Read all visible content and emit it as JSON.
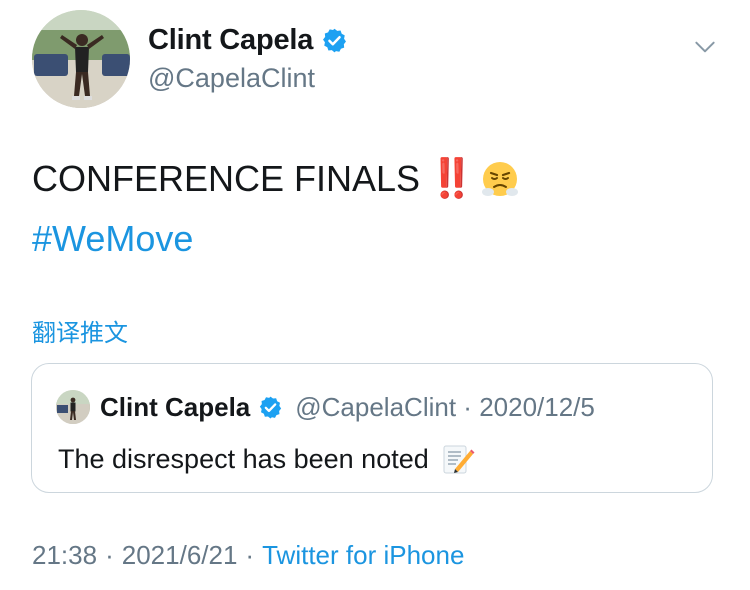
{
  "author": {
    "display_name": "Clint Capela",
    "handle": "@CapelaClint",
    "verified": true
  },
  "tweet": {
    "text": "CONFERENCE FINALS",
    "emphasis_emoji": "‼️",
    "emoji": "face-with-steam-from-nose",
    "hashtag": "#WeMove",
    "translate_label": "翻译推文"
  },
  "quoted_tweet": {
    "display_name": "Clint Capela",
    "handle": "@CapelaClint",
    "date": "2020/12/5",
    "separator": "·",
    "text": "The disrespect has been noted",
    "emoji": "memo-icon"
  },
  "footer": {
    "time": "21:38",
    "date": "2021/6/21",
    "separator": "·",
    "source": "Twitter for iPhone"
  },
  "colors": {
    "link": "#1b95e0",
    "muted": "#657786",
    "verified": "#1da1f2",
    "border": "#ccd6dd"
  }
}
